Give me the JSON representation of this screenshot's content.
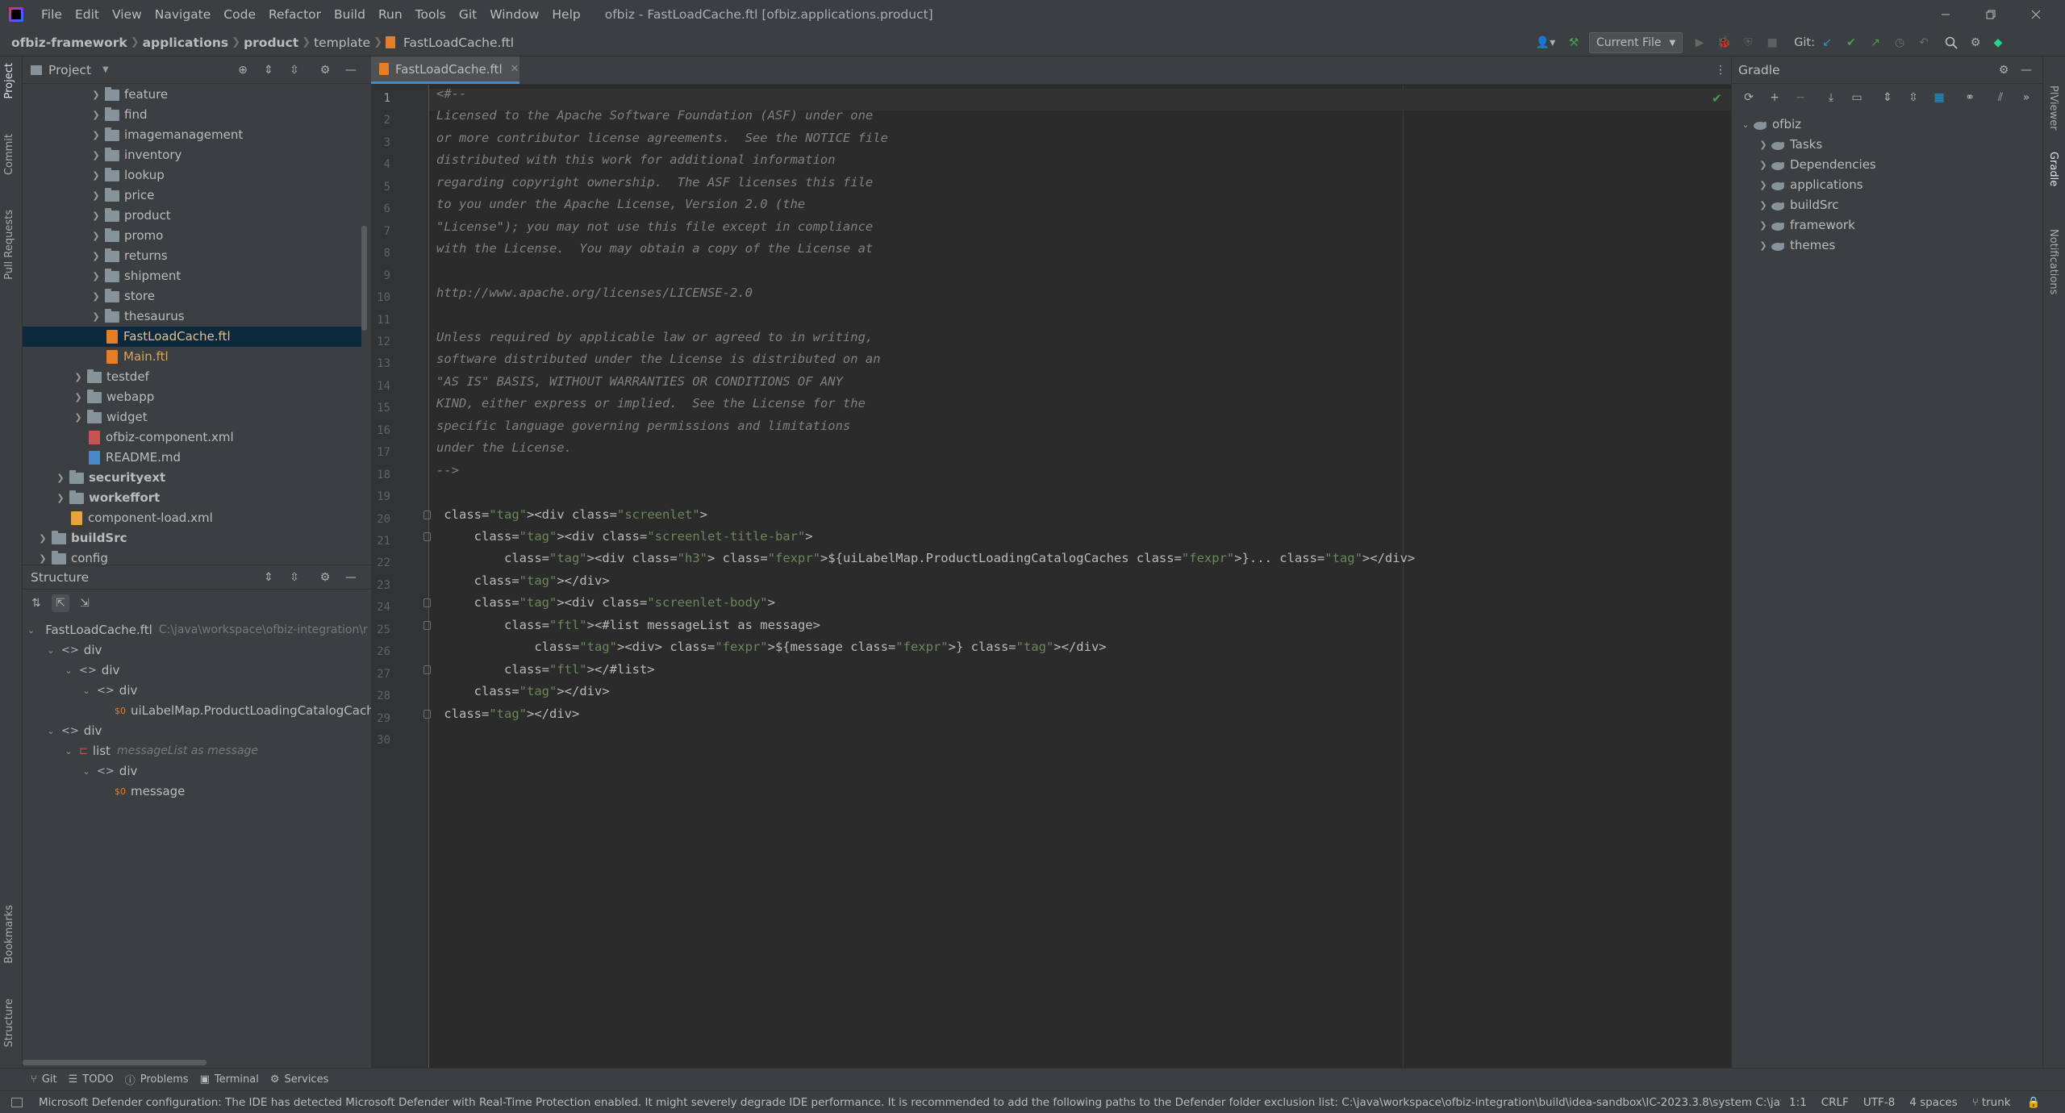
{
  "menu": [
    "File",
    "Edit",
    "View",
    "Navigate",
    "Code",
    "Refactor",
    "Build",
    "Run",
    "Tools",
    "Git",
    "Window",
    "Help"
  ],
  "window_title": "ofbiz - FastLoadCache.ftl [ofbiz.applications.product]",
  "breadcrumb": [
    "ofbiz-framework",
    "applications",
    "product",
    "template",
    "FastLoadCache.ftl"
  ],
  "toolbar": {
    "run_config": "Current File",
    "git_label": "Git:"
  },
  "project": {
    "title": "Project",
    "rows": [
      {
        "label": "feature",
        "kind": "folder",
        "depth": 3
      },
      {
        "label": "find",
        "kind": "folder",
        "depth": 3
      },
      {
        "label": "imagemanagement",
        "kind": "folder",
        "depth": 3
      },
      {
        "label": "inventory",
        "kind": "folder",
        "depth": 3
      },
      {
        "label": "lookup",
        "kind": "folder",
        "depth": 3
      },
      {
        "label": "price",
        "kind": "folder",
        "depth": 3
      },
      {
        "label": "product",
        "kind": "folder",
        "depth": 3
      },
      {
        "label": "promo",
        "kind": "folder",
        "depth": 3
      },
      {
        "label": "returns",
        "kind": "folder",
        "depth": 3
      },
      {
        "label": "shipment",
        "kind": "folder",
        "depth": 3
      },
      {
        "label": "store",
        "kind": "folder",
        "depth": 3
      },
      {
        "label": "thesaurus",
        "kind": "folder",
        "depth": 3
      },
      {
        "label": "FastLoadCache.ftl",
        "kind": "ftl",
        "depth": 3
      },
      {
        "label": "Main.ftl",
        "kind": "ftl",
        "depth": 3
      },
      {
        "label": "testdef",
        "kind": "folder",
        "depth": 2
      },
      {
        "label": "webapp",
        "kind": "folder",
        "depth": 2
      },
      {
        "label": "widget",
        "kind": "folder",
        "depth": 2
      },
      {
        "label": "ofbiz-component.xml",
        "kind": "xml",
        "depth": 2
      },
      {
        "label": "README.md",
        "kind": "md",
        "depth": 2
      },
      {
        "label": "securityext",
        "kind": "module",
        "depth": 1
      },
      {
        "label": "workeffort",
        "kind": "module",
        "depth": 1
      },
      {
        "label": "component-load.xml",
        "kind": "xml2",
        "depth": 1
      },
      {
        "label": "buildSrc",
        "kind": "module",
        "depth": 0
      },
      {
        "label": "config",
        "kind": "folder",
        "depth": 0
      }
    ]
  },
  "structure": {
    "title": "Structure",
    "root_file": "FastLoadCache.ftl",
    "root_path": "C:\\java\\workspace\\ofbiz-integration\\r",
    "rows": [
      {
        "label": "div",
        "hint": "",
        "kind": "tag"
      },
      {
        "label": "div",
        "hint": "",
        "kind": "tag"
      },
      {
        "label": "div",
        "hint": "",
        "kind": "tag"
      },
      {
        "label": "uiLabelMap.ProductLoadingCatalogCaches",
        "hint": "",
        "kind": "expr"
      },
      {
        "label": "div",
        "hint": "",
        "kind": "tag"
      },
      {
        "label": "list",
        "hint": "messageList as message",
        "kind": "list"
      },
      {
        "label": "div",
        "hint": "",
        "kind": "tag"
      },
      {
        "label": "message",
        "hint": "",
        "kind": "expr"
      }
    ]
  },
  "editor": {
    "tab_label": "FastLoadCache.ftl",
    "line_numbers": [
      "1",
      "2",
      "3",
      "4",
      "5",
      "6",
      "7",
      "8",
      "9",
      "10",
      "11",
      "12",
      "13",
      "14",
      "15",
      "16",
      "17",
      "18",
      "19",
      "20",
      "21",
      "22",
      "23",
      "24",
      "25",
      "26",
      "27",
      "28",
      "29",
      "30"
    ],
    "lines": [
      "<#--",
      "Licensed to the Apache Software Foundation (ASF) under one",
      "or more contributor license agreements.  See the NOTICE file",
      "distributed with this work for additional information",
      "regarding copyright ownership.  The ASF licenses this file",
      "to you under the Apache License, Version 2.0 (the",
      "\"License\"); you may not use this file except in compliance",
      "with the License.  You may obtain a copy of the License at",
      "",
      "http://www.apache.org/licenses/LICENSE-2.0",
      "",
      "Unless required by applicable law or agreed to in writing,",
      "software distributed under the License is distributed on an",
      "\"AS IS\" BASIS, WITHOUT WARRANTIES OR CONDITIONS OF ANY",
      "KIND, either express or implied.  See the License for the",
      "specific language governing permissions and limitations",
      "under the License.",
      "-->",
      "",
      "<div class=\"screenlet\">",
      "    <div class=\"screenlet-title-bar\">",
      "        <div class=\"h3\">${uiLabelMap.ProductLoadingCatalogCaches}...</div>",
      "    </div>",
      "    <div class=\"screenlet-body\">",
      "        <#list messageList as message>",
      "            <div>${message}</div>",
      "        </#list>",
      "    </div>",
      "</div>",
      ""
    ]
  },
  "gradle": {
    "title": "Gradle",
    "root": "ofbiz",
    "items": [
      "Tasks",
      "Dependencies",
      "applications",
      "buildSrc",
      "framework",
      "themes"
    ]
  },
  "left_stripe": [
    "Project",
    "Commit",
    "Pull Requests",
    "Bookmarks",
    "Structure"
  ],
  "right_stripe": [
    "PlViewer",
    "Gradle",
    "Notifications"
  ],
  "bottom_tabs": [
    "Git",
    "TODO",
    "Problems",
    "Terminal",
    "Services"
  ],
  "status": {
    "message": "Microsoft Defender configuration: The IDE has detected Microsoft Defender with Real-Time Protection enabled. It might severely degrade IDE performance. It is recommended to add the following paths to the Defender folder exclusion list: C:\\java\\workspace\\ofbiz-integration\\build\\idea-sandbox\\IC-2023.3.8\\system C:\\java",
    "position": "1:1",
    "line_sep": "CRLF",
    "encoding": "UTF-8",
    "indent": "4 spaces",
    "branch": "trunk"
  },
  "colors": {
    "accent": "#3592c4",
    "selection": "#0d293e",
    "ftl_icon": "#e57e26",
    "green": "#499c54"
  }
}
